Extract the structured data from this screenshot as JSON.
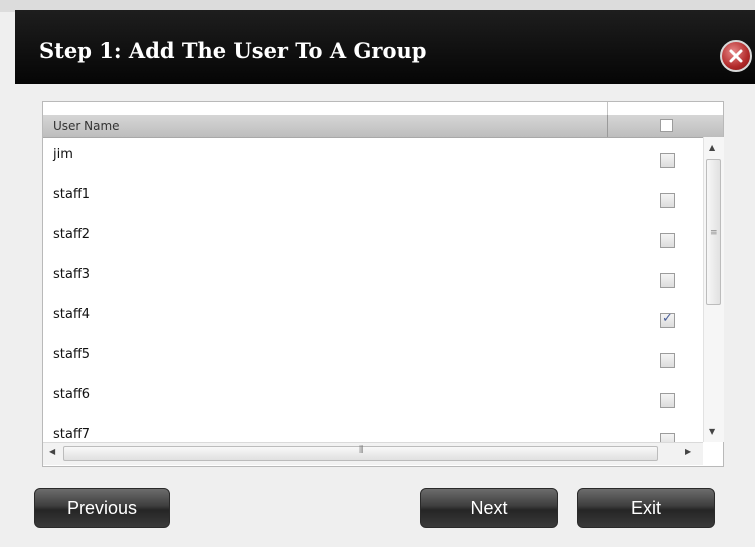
{
  "dialog": {
    "title": "Step 1: Add The User To A Group"
  },
  "table": {
    "columns": [
      "User Name",
      ""
    ],
    "header_checked": false,
    "rows": [
      {
        "name": "jim",
        "checked": false
      },
      {
        "name": "staff1",
        "checked": false
      },
      {
        "name": "staff2",
        "checked": false
      },
      {
        "name": "staff3",
        "checked": false
      },
      {
        "name": "staff4",
        "checked": true
      },
      {
        "name": "staff5",
        "checked": false
      },
      {
        "name": "staff6",
        "checked": false
      },
      {
        "name": "staff7",
        "checked": false
      }
    ]
  },
  "buttons": {
    "previous": "Previous",
    "next": "Next",
    "exit": "Exit"
  },
  "icons": {
    "close": "close-icon",
    "scroll_up": "arrow-up-icon",
    "scroll_down": "arrow-down-icon",
    "scroll_left": "arrow-left-icon",
    "scroll_right": "arrow-right-icon"
  },
  "colors": {
    "title_bar": "#0a0a0a",
    "close_button": "#c03a3a",
    "check_mark": "#4a5f9a"
  }
}
